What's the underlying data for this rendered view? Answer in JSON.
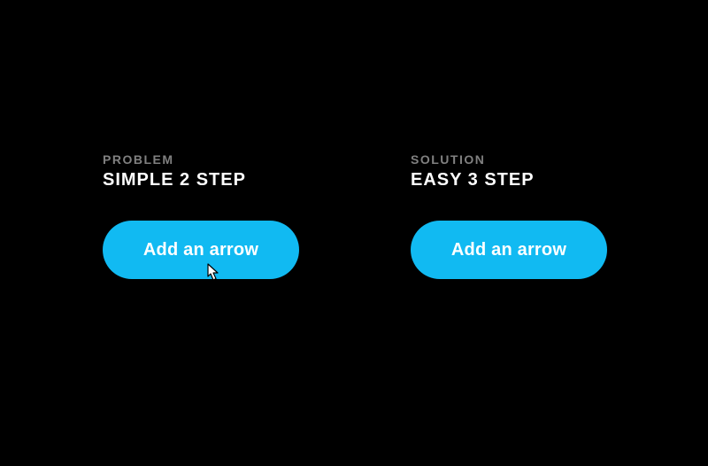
{
  "left": {
    "eyebrow": "PROBLEM",
    "heading": "SIMPLE 2 STEP",
    "button_label": "Add an arrow"
  },
  "right": {
    "eyebrow": "SOLUTION",
    "heading": "EASY 3 STEP",
    "button_label": "Add an arrow"
  },
  "colors": {
    "accent": "#11baf2",
    "muted": "#808080",
    "text": "#ffffff",
    "bg": "#000000"
  }
}
